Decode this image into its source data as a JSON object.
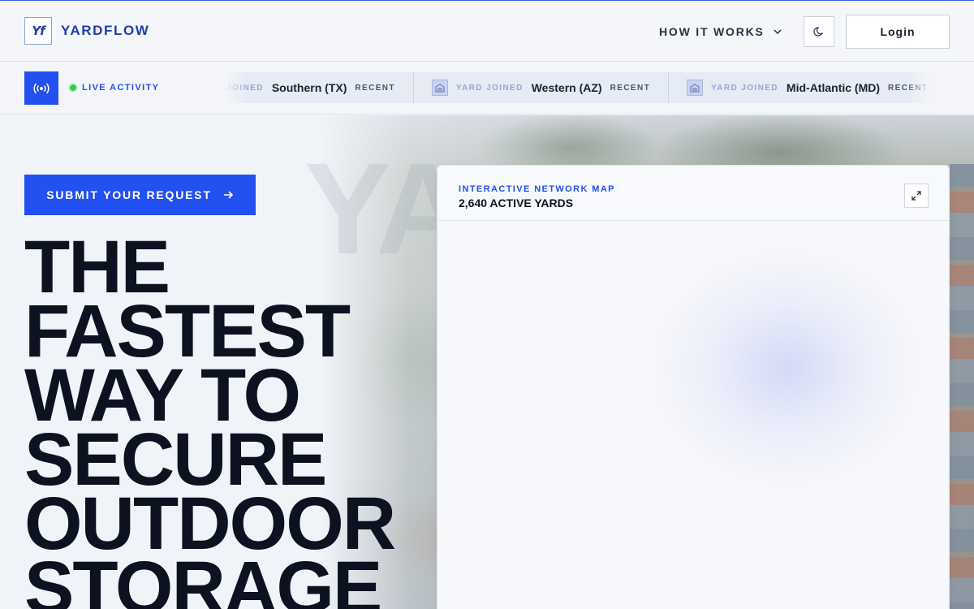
{
  "header": {
    "brand": "YARDFLOW",
    "logo_mark": "Yf",
    "nav_how": "HOW IT WORKS",
    "login": "Login",
    "accent": "#1f3fa6"
  },
  "activity": {
    "label": "LIVE ACTIVITY",
    "items": [
      {
        "joined": "YARD JOINED",
        "region": "Southern (TX)",
        "recent": "RECENT"
      },
      {
        "joined": "YARD JOINED",
        "region": "Western (AZ)",
        "recent": "RECENT"
      },
      {
        "joined": "YARD JOINED",
        "region": "Mid-Atlantic (MD)",
        "recent": "RECENT"
      }
    ]
  },
  "hero": {
    "cta": "SUBMIT YOUR REQUEST",
    "headline": [
      "THE",
      "FASTEST",
      "WAY TO",
      "SECURE",
      "OUTDOOR",
      "STORAGE"
    ],
    "ghost": "YA"
  },
  "map": {
    "kicker": "INTERACTIVE NETWORK MAP",
    "count": "2,640 ACTIVE YARDS"
  },
  "colors": {
    "primary": "#2350f0",
    "live_dot": "#2ecc5a",
    "text_dark": "#0d1220"
  }
}
